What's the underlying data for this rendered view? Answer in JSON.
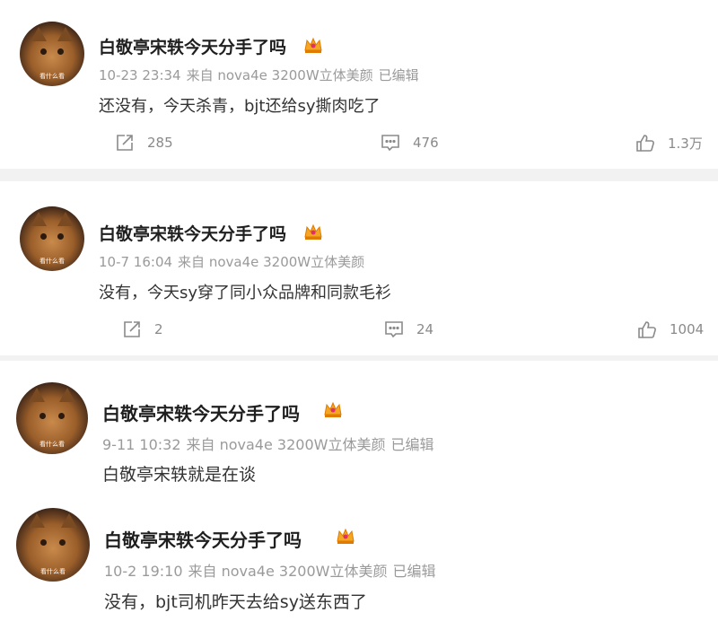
{
  "comments": [
    {
      "username": "白敬亭宋轶今天分手了吗",
      "avatar_caption": "看什么看",
      "date": "10-23 23:34",
      "source": "来自 nova4e 3200W立体美颜",
      "edited": "已编辑",
      "text": "还没有，今天杀青，bjt还给sy撕肉吃了",
      "reposts": "285",
      "comments": "476",
      "likes": "1.3万"
    },
    {
      "username": "白敬亭宋轶今天分手了吗",
      "avatar_caption": "看什么看",
      "date": "10-7 16:04",
      "source": "来自 nova4e 3200W立体美颜",
      "edited": "",
      "text": "没有，今天sy穿了同小众品牌和同款毛衫",
      "reposts": "2",
      "comments": "24",
      "likes": "1004"
    },
    {
      "username": "白敬亭宋轶今天分手了吗",
      "avatar_caption": "看什么看",
      "date": "9-11 10:32",
      "source": "来自 nova4e 3200W立体美颜",
      "edited": "已编辑",
      "text": "白敬亭宋轶就是在谈"
    },
    {
      "username": "白敬亭宋轶今天分手了吗",
      "avatar_caption": "看什么看",
      "date": "10-2 19:10",
      "source": "来自 nova4e 3200W立体美颜",
      "edited": "已编辑",
      "text": "没有，bjt司机昨天去给sy送东西了"
    }
  ],
  "colors": {
    "separator": "#f2f2f2",
    "crown": "#f5a623",
    "meta": "#9a9a9a"
  },
  "icons": {
    "repost": "repost-icon",
    "comment": "comment-icon",
    "like": "like-icon",
    "crown": "crown-icon"
  }
}
